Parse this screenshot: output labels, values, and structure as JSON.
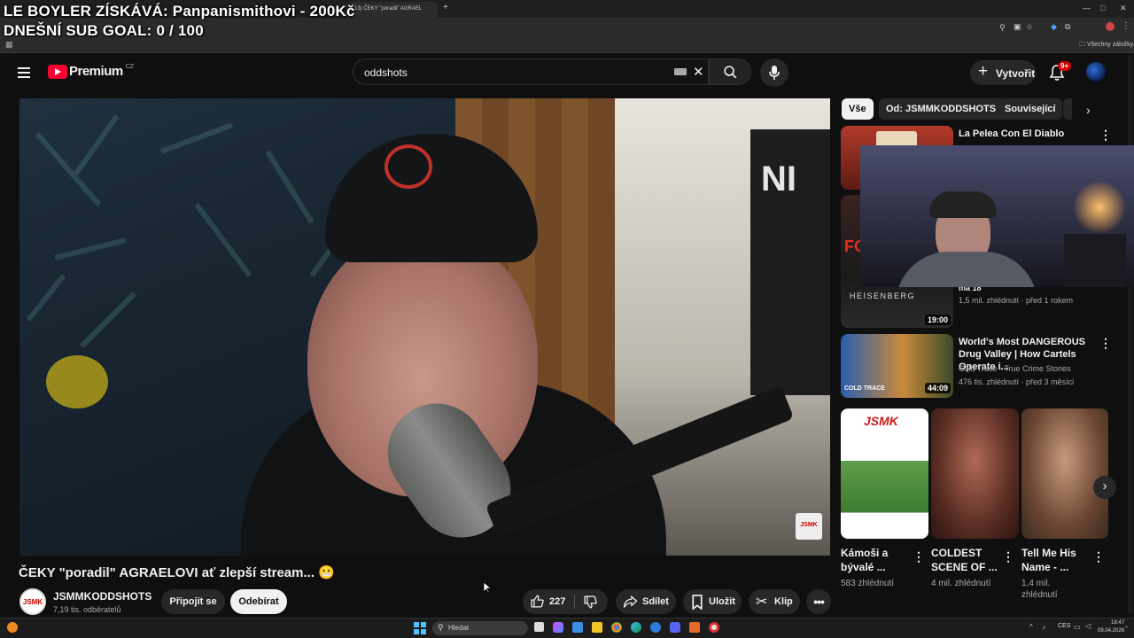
{
  "overlay": {
    "line1": "LE BOYLER ZÍSKÁVÁ: Panpanismithovi - 200Kč",
    "line2": "DNEŠNÍ SUB GOAL: 0 / 100"
  },
  "browser": {
    "tab_title": "(13) ČEKY \"poradil\" AGRAEL",
    "bookmarks_label": "Všechny záložky"
  },
  "header": {
    "logo_text": "Premium",
    "logo_region": "CZ",
    "search_value": "oddshots",
    "create_label": "Vytvořit",
    "notif_count": "9+"
  },
  "video": {
    "title": "ČEKY \"poradil\" AGRAELOVI ať zlepší stream... 😬",
    "channel_name": "JSMMKODDSHOTS",
    "subscribers": "7,19 tis. odběratelů",
    "join_label": "Připojit se",
    "subscribe_label": "Odebírat",
    "likes": "227",
    "share_label": "Sdílet",
    "save_label": "Uložit",
    "clip_label": "Klip"
  },
  "sidebar": {
    "chips": [
      "Vše",
      "Od: JSMMKODDSHOTS",
      "Související"
    ],
    "recs": [
      {
        "title": "La Pelea Con El Diablo",
        "meta1": "",
        "meta2": "",
        "duration": ""
      },
      {
        "title": "",
        "meta1": "1,5 mil. zhlédnutí · před 1 rokem",
        "meta2": "",
        "duration": "19:00",
        "thumb_text": "HEISENBERG",
        "title_frag": "ma 18"
      },
      {
        "title": "World's Most DANGEROUS Drug Valley | How Cartels Operate i...",
        "meta1": "Cold Trace - True Crime Stories",
        "meta2": "476 tis. zhlédnutí · před 3 měsíci",
        "duration": "44:09",
        "thumb_text": "COLD TRACE"
      }
    ],
    "shorts": [
      {
        "title": "Kámoši a bývalé ...",
        "views": "583 zhlédnutí"
      },
      {
        "title": "COLDEST SCENE OF ...",
        "views": "4 mil. zhlédnutí"
      },
      {
        "title": "Tell Me His Name - ...",
        "views": "1,4 mil. zhlédnutí"
      }
    ]
  },
  "taskbar": {
    "search_placeholder": "Hledat",
    "lang": "CES",
    "time": "18:47",
    "date": "09.04.2026"
  }
}
